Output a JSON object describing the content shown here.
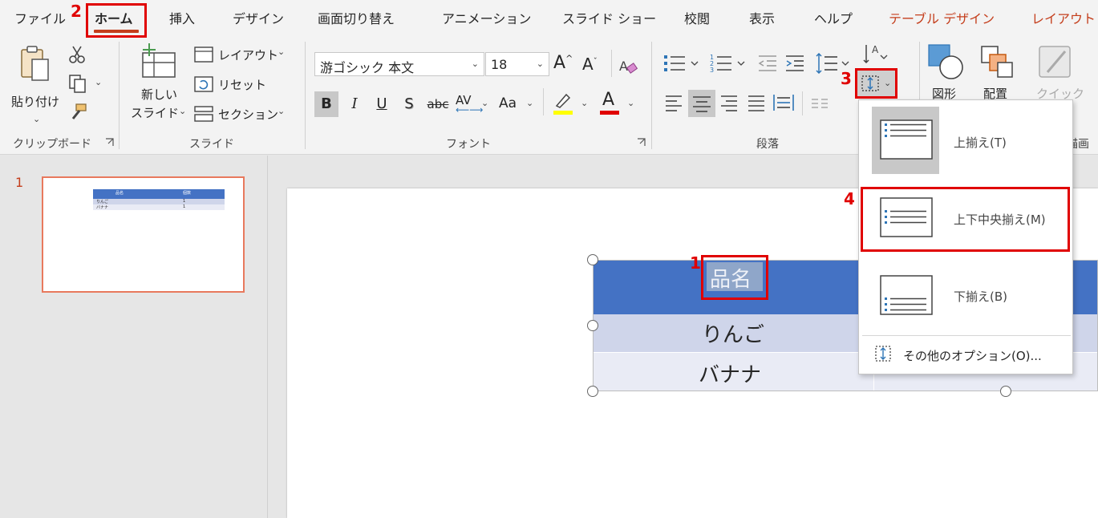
{
  "menu": {
    "tabs": [
      "ファイル",
      "ホーム",
      "挿入",
      "デザイン",
      "画面切り替え",
      "アニメーション",
      "スライド ショー",
      "校閲",
      "表示",
      "ヘルプ",
      "テーブル デザイン",
      "レイアウト"
    ]
  },
  "clipboard": {
    "paste_label": "貼り付け",
    "group_label": "クリップボード"
  },
  "slides": {
    "new_slide_line1": "新しい",
    "new_slide_line2": "スライド",
    "layout_label": "レイアウト",
    "reset_label": "リセット",
    "section_label": "セクション",
    "group_label": "スライド"
  },
  "font": {
    "font_name": "游ゴシック 本文",
    "font_size": "18",
    "bold": "B",
    "italic": "I",
    "underline": "U",
    "shadow": "S",
    "strike": "abc",
    "spacing": "AV",
    "case": "Aa",
    "font_color": "A",
    "grow": "A",
    "shrink": "A",
    "group_label": "フォント"
  },
  "paragraph": {
    "group_label": "段落"
  },
  "drawing": {
    "shapes_label": "図形",
    "arrange_label": "配置",
    "quick_label": "クイック",
    "group_label": "描画"
  },
  "colors": {
    "accent": "#c43e1c",
    "header_fill": "#4472c4",
    "row1_fill": "#cfd5ea",
    "row2_fill": "#e9ebf5",
    "highlight": "#ffff00",
    "font_red": "#e00000",
    "annotation": "#e00000"
  },
  "thumbnail": {
    "slide_number": "1",
    "h1": "品名",
    "h2": "個数",
    "r1a": "りんご",
    "r1b": "1",
    "r2a": "バナナ",
    "r2b": "1"
  },
  "table": {
    "header": "品名",
    "row1": "りんご",
    "row2": "バナナ"
  },
  "dropdown": {
    "top_align": "上揃え(T)",
    "middle_align": "上下中央揃え(M)",
    "bottom_align": "下揃え(B)",
    "more_options": "その他のオプション(O)..."
  },
  "annotations": {
    "n1": "1",
    "n2": "2",
    "n3": "3",
    "n4": "4"
  }
}
